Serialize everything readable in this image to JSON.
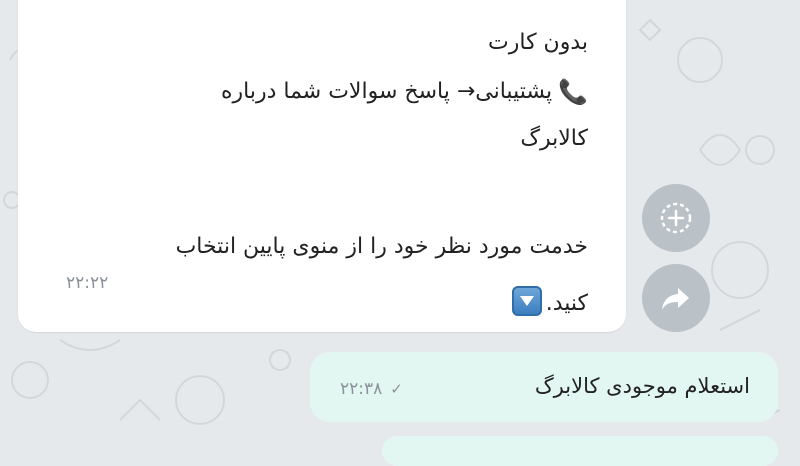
{
  "incoming_message": {
    "lines": [
      "بدون کارت",
      "پشتیبانی→ پاسخ سوالات شما درباره",
      "کالابرگ",
      "خدمت مورد نظر خود را از منوی پایین انتخاب",
      "کنید."
    ],
    "phone_emoji": "📞",
    "time": "۲۲:۲۲"
  },
  "outgoing_message": {
    "text": "استعلام موجودی کالابرگ",
    "time": "۲۲:۳۸",
    "status": "✓"
  },
  "side_buttons": {
    "add_icon": "add-circle-icon",
    "share_icon": "share-icon"
  },
  "colors": {
    "background": "#e6e9ec",
    "incoming_bubble": "#ffffff",
    "outgoing_bubble": "#e3f7f2",
    "timestamp": "#8a9199"
  }
}
